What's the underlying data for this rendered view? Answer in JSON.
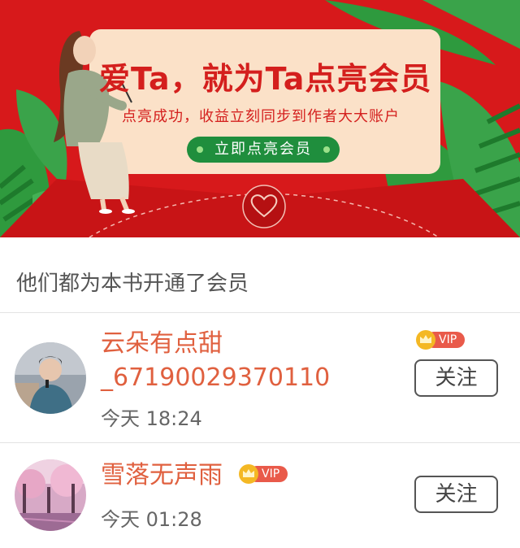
{
  "banner": {
    "title": "爱Ta，就为Ta点亮会员",
    "subtitle": "点亮成功，收益立刻同步到作者大大账户",
    "cta_label": "立即点亮会员"
  },
  "section": {
    "title": "他们都为本书开通了会员"
  },
  "members": [
    {
      "name_line1": "云朵有点甜",
      "name_line2": "_67190029370110",
      "time": "今天 18:24",
      "vip_label": "VIP",
      "follow_label": "关注"
    },
    {
      "name_line1": "雪落无声雨",
      "time": "今天 01:28",
      "vip_label": "VIP",
      "follow_label": "关注"
    }
  ],
  "colors": {
    "banner_red": "#d7191b",
    "card_cream": "#fbe1c8",
    "cta_green": "#1f8e3d",
    "name_orange": "#e0603f"
  }
}
